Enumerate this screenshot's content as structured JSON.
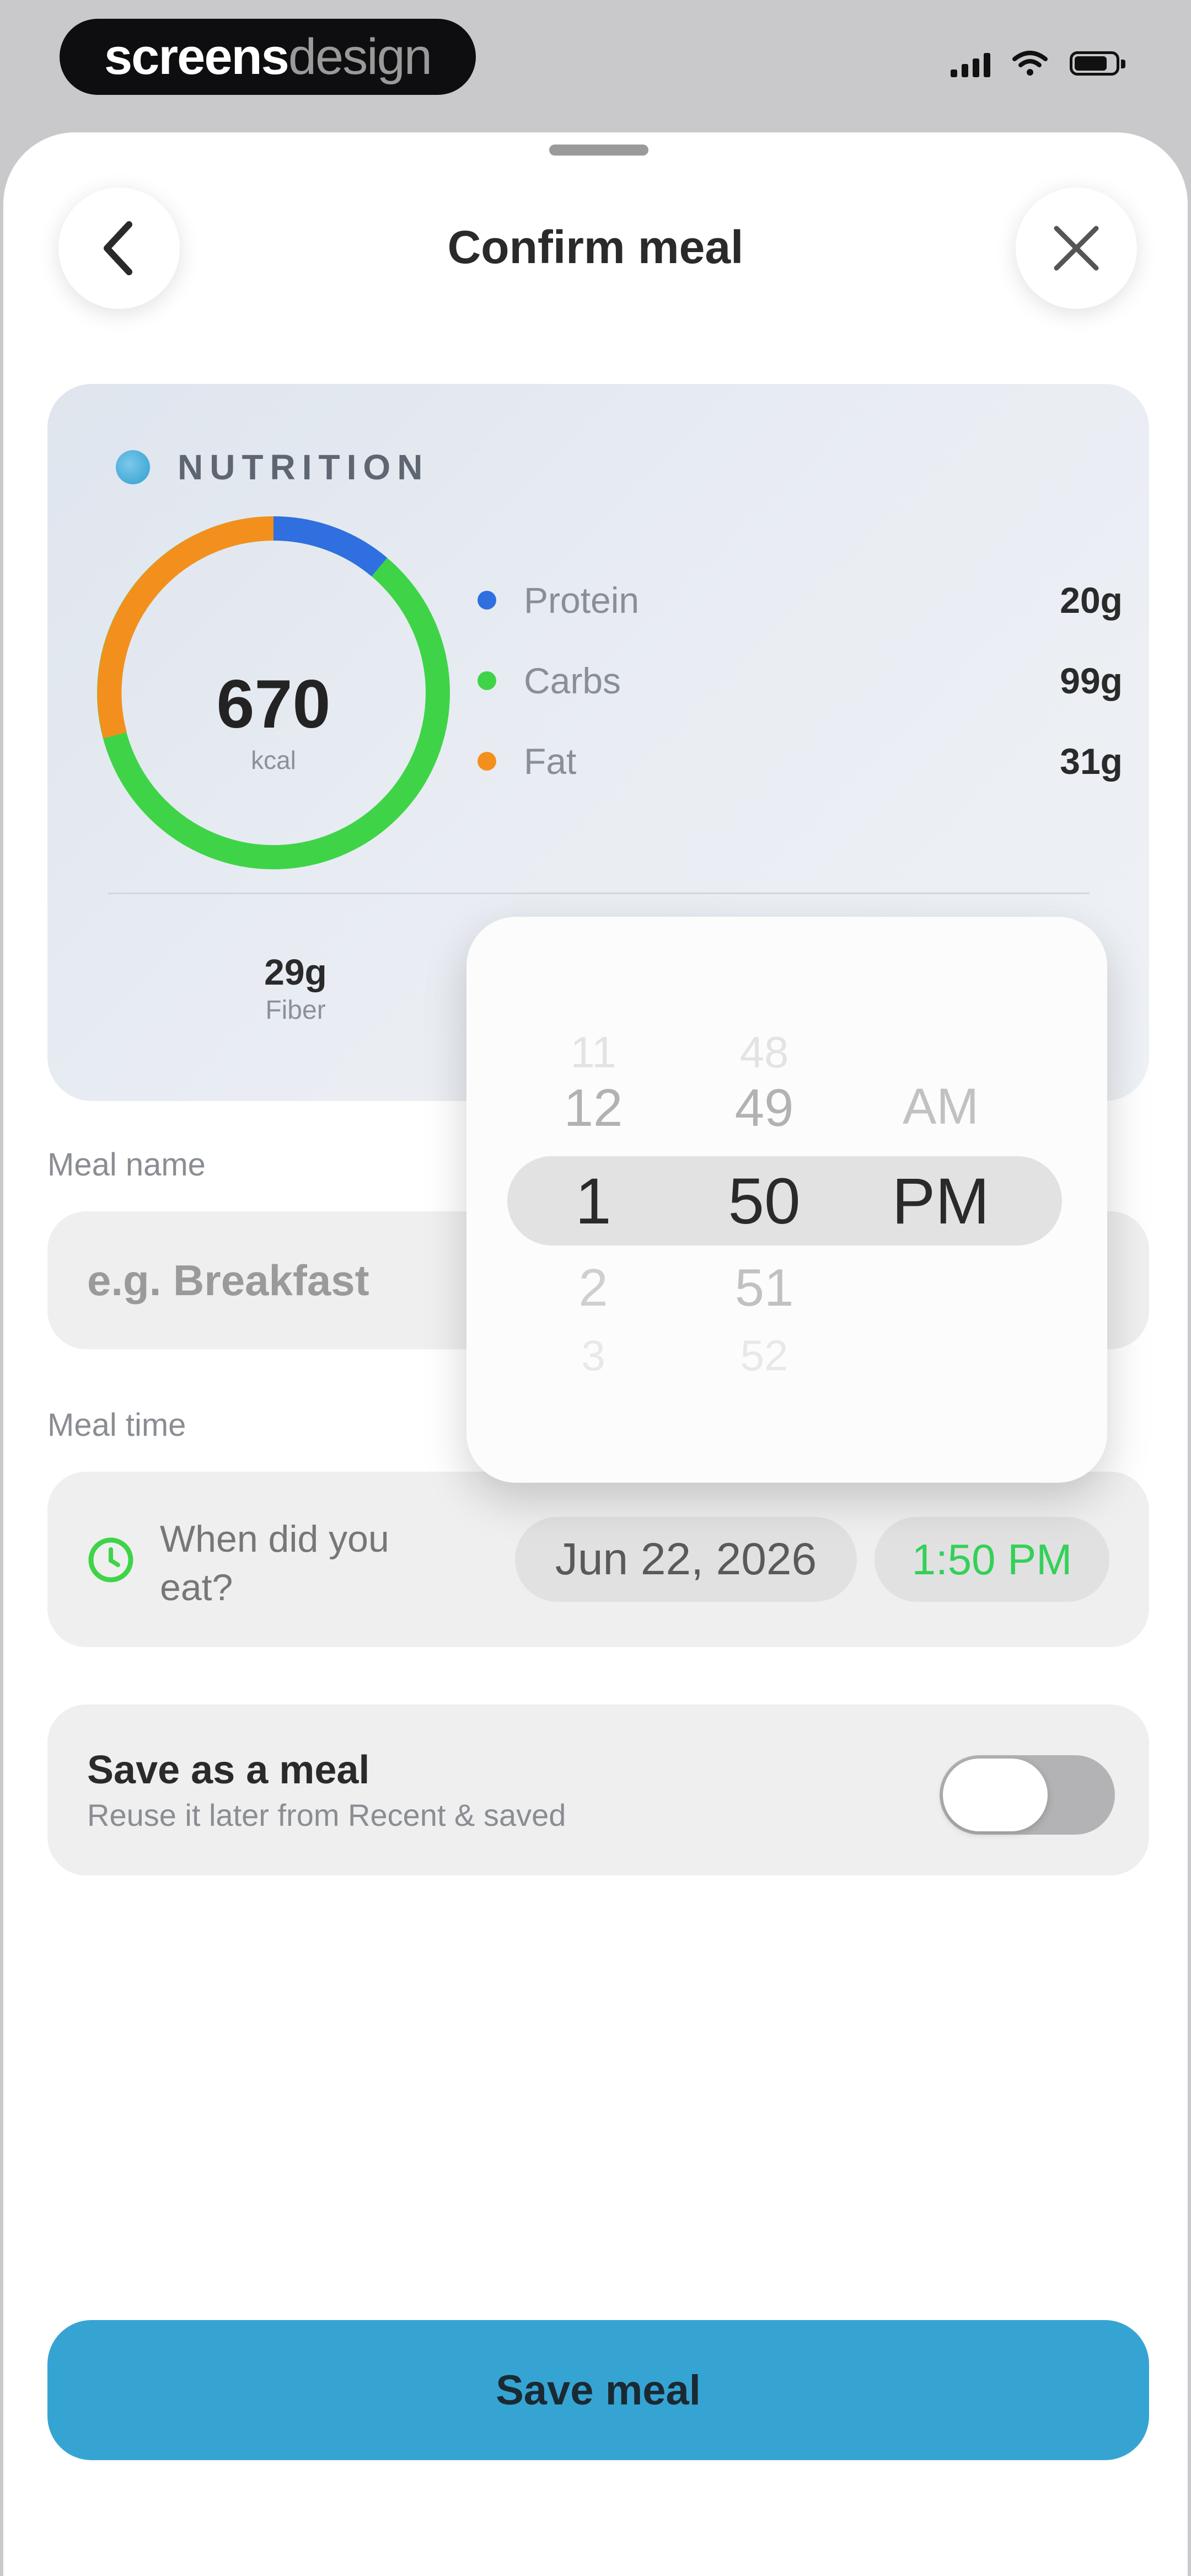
{
  "status_bar": {
    "brand_part1": "screens",
    "brand_part2": "design"
  },
  "header": {
    "title": "Confirm meal",
    "back_icon": "chevron-left-icon",
    "close_icon": "close-icon"
  },
  "nutrition": {
    "label": "NUTRITION",
    "calories": "670",
    "calories_unit": "kcal",
    "macros": [
      {
        "name": "Protein",
        "value": "20g",
        "color": "#2f6fe0"
      },
      {
        "name": "Carbs",
        "value": "99g",
        "color": "#3fd448"
      },
      {
        "name": "Fat",
        "value": "31g",
        "color": "#f3901d"
      }
    ],
    "fiber_value": "29g",
    "fiber_label": "Fiber"
  },
  "meal_name": {
    "label": "Meal name",
    "placeholder": "e.g. Breakfast"
  },
  "meal_time": {
    "label": "Meal time",
    "prompt": "When did you eat?",
    "date": "Jun 22, 2026",
    "time": "1:50 PM"
  },
  "time_picker": {
    "hours": [
      "11",
      "12",
      "1",
      "2",
      "3"
    ],
    "minutes": [
      "48",
      "49",
      "50",
      "51",
      "52"
    ],
    "periods": [
      "AM",
      "PM"
    ],
    "selected_hour": "1",
    "selected_minute": "50",
    "selected_period": "PM"
  },
  "save_as_meal": {
    "title": "Save as a meal",
    "subtitle": "Reuse it later from Recent & saved",
    "enabled": false
  },
  "save_button": {
    "label": "Save meal"
  },
  "colors": {
    "accent": "#36a4d3",
    "protein": "#2f6fe0",
    "carbs": "#3fd448",
    "fat": "#f3901d",
    "time_text": "#34d058"
  }
}
